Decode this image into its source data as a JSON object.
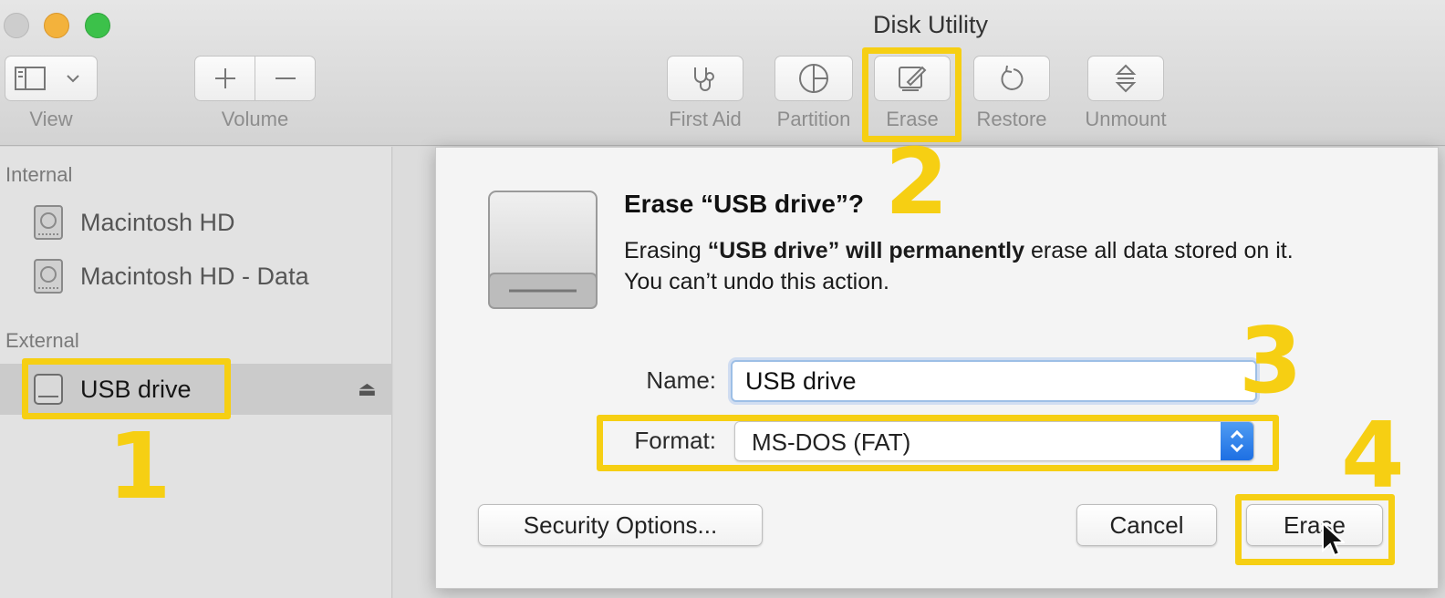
{
  "window": {
    "title": "Disk Utility"
  },
  "toolbar": {
    "view_label": "View",
    "volume_label": "Volume",
    "first_aid_label": "First Aid",
    "partition_label": "Partition",
    "erase_label": "Erase",
    "restore_label": "Restore",
    "unmount_label": "Unmount"
  },
  "sidebar": {
    "internal_header": "Internal",
    "external_header": "External",
    "internal_items": [
      {
        "label": "Macintosh HD"
      },
      {
        "label": "Macintosh HD - Data"
      }
    ],
    "external_items": [
      {
        "label": "USB drive",
        "selected": true
      }
    ]
  },
  "sheet": {
    "title": "Erase “USB drive”?",
    "message_prefix": "Erasing ",
    "message_bold": "“USB drive” will permanently",
    "message_suffix": " erase all data stored on it.",
    "message_line2": "You can’t undo this action.",
    "name_label": "Name:",
    "name_value": "USB drive",
    "format_label": "Format:",
    "format_value": "MS-DOS (FAT)",
    "security_options_label": "Security Options...",
    "cancel_label": "Cancel",
    "erase_label": "Erase"
  },
  "annotations": {
    "step1": "1",
    "step2": "2",
    "step3": "3",
    "step4": "4",
    "highlight_color": "#f6cf13"
  },
  "colors": {
    "accent": "#1d6fe3",
    "traffic_min": "#f3b23c",
    "traffic_max": "#3cc14a"
  }
}
